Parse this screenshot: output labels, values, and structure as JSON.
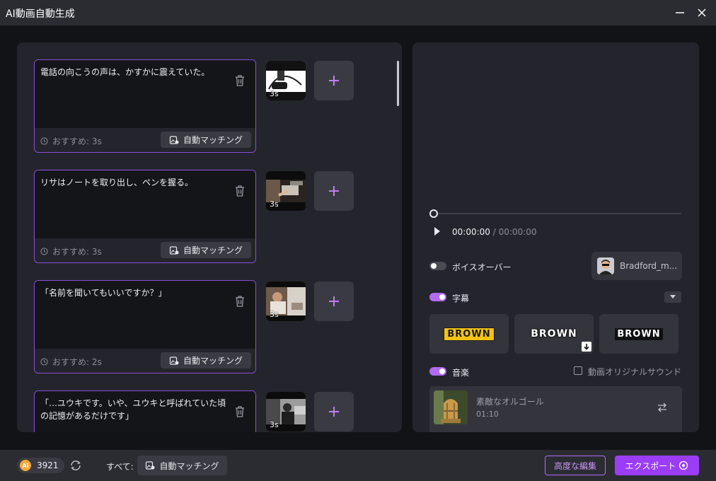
{
  "window": {
    "title": "AI動画自動生成"
  },
  "scenes": [
    {
      "text": "電話の向こうの声は、かすかに震えていた。",
      "recommend": "おすすめ: 3s",
      "match_label": "自動マッチング",
      "duration": "3s"
    },
    {
      "text": "リサはノートを取り出し、ペンを握る。",
      "recommend": "おすすめ: 3s",
      "match_label": "自動マッチング",
      "duration": "3s"
    },
    {
      "text": "「名前を聞いてもいいですか？」",
      "recommend": "おすすめ: 2s",
      "match_label": "自動マッチング",
      "duration": "3s"
    },
    {
      "text": "「…ユウキです。いや、ユウキと呼ばれていた頃の記憶があるだけです」",
      "recommend": "",
      "match_label": "",
      "duration": "3s"
    }
  ],
  "player": {
    "current_time": "00:00:00",
    "total_time": "/ 00:00:00",
    "progress": 0
  },
  "voiceover": {
    "label": "ボイスオーバー",
    "enabled": false,
    "voice_name": "Bradford_m..."
  },
  "subtitles": {
    "label": "字幕",
    "enabled": true,
    "styles": [
      "BROWN",
      "BROWN",
      "BROWN"
    ]
  },
  "music": {
    "label": "音楽",
    "enabled": true,
    "original_sound_label": "動画オリジナルサウンド",
    "original_sound_checked": false,
    "track_title": "素敵なオルゴール",
    "track_duration": "01:10"
  },
  "footer": {
    "credits": "3921",
    "coin_label": "AI",
    "all_label": "すべて:",
    "all_match_label": "自動マッチング",
    "advanced_edit_label": "高度な編集",
    "export_label": "エクスポート"
  },
  "colors": {
    "accent": "#9b3df5",
    "scene_border": "#8a4fd6",
    "toggle_on": "#b06cf2",
    "background": "#121317",
    "panel": "#24252c"
  }
}
